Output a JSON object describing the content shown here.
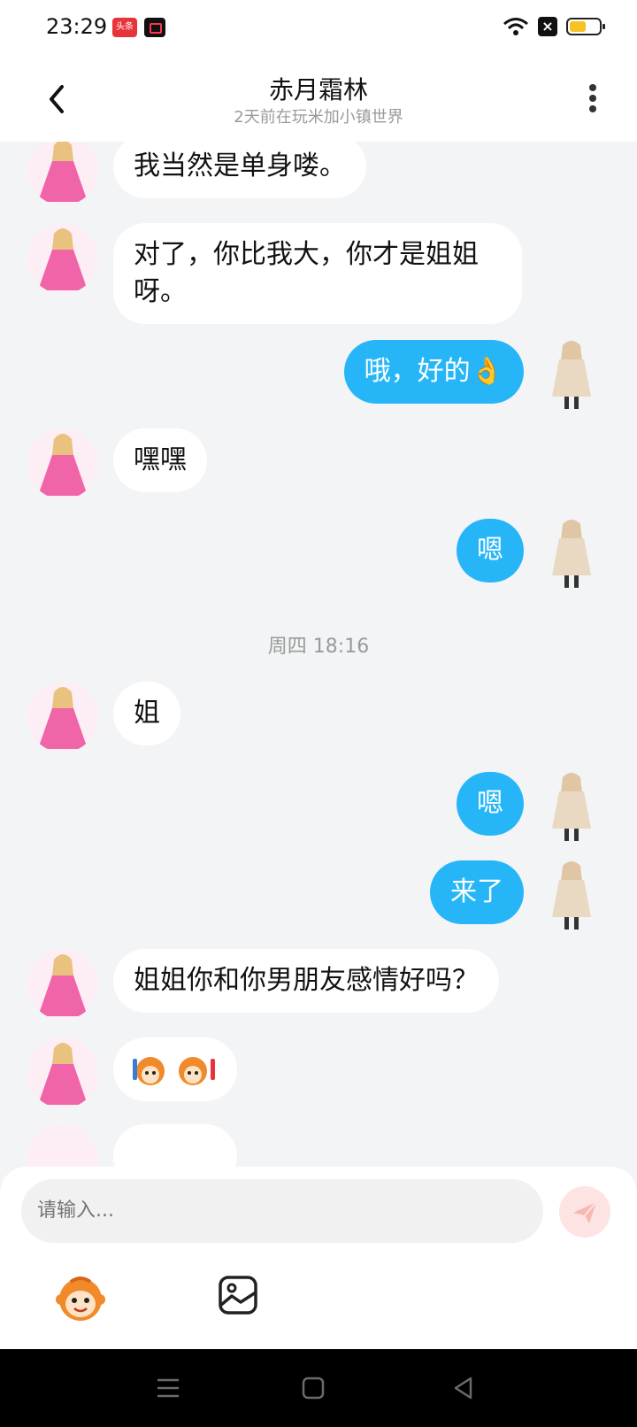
{
  "status": {
    "time": "23:29",
    "toutiao_label": "头条",
    "battery_level": 0.55
  },
  "header": {
    "title": "赤月霜林",
    "subtitle": "2天前在玩米加小镇世界"
  },
  "messages": [
    {
      "side": "left",
      "text": "我当然是单身喽。"
    },
    {
      "side": "left",
      "text": "对了，你比我大，你才是姐姐呀。"
    },
    {
      "side": "right",
      "text": "哦，好的👌"
    },
    {
      "side": "left",
      "text": "嘿嘿"
    },
    {
      "side": "right",
      "text": "嗯"
    },
    {
      "side": "left",
      "text": "姐"
    },
    {
      "side": "right",
      "text": "嗯"
    },
    {
      "side": "right",
      "text": "来了"
    },
    {
      "side": "left",
      "text": "姐姐你和你男朋友感情好吗？"
    }
  ],
  "timestamp": "周四 18:16",
  "composer": {
    "placeholder": "请输入..."
  },
  "icons": {
    "back": "back-arrow-icon",
    "more": "more-vert-icon",
    "send": "send-icon",
    "emoji": "monkey-emoji-icon",
    "image": "image-icon",
    "nav_menu": "menu-icon",
    "nav_home": "home-icon",
    "nav_back": "back-triangle-icon"
  },
  "colors": {
    "accent": "#26b6f7",
    "send_disabled": "#fde4e2",
    "background": "#f3f4f6"
  }
}
